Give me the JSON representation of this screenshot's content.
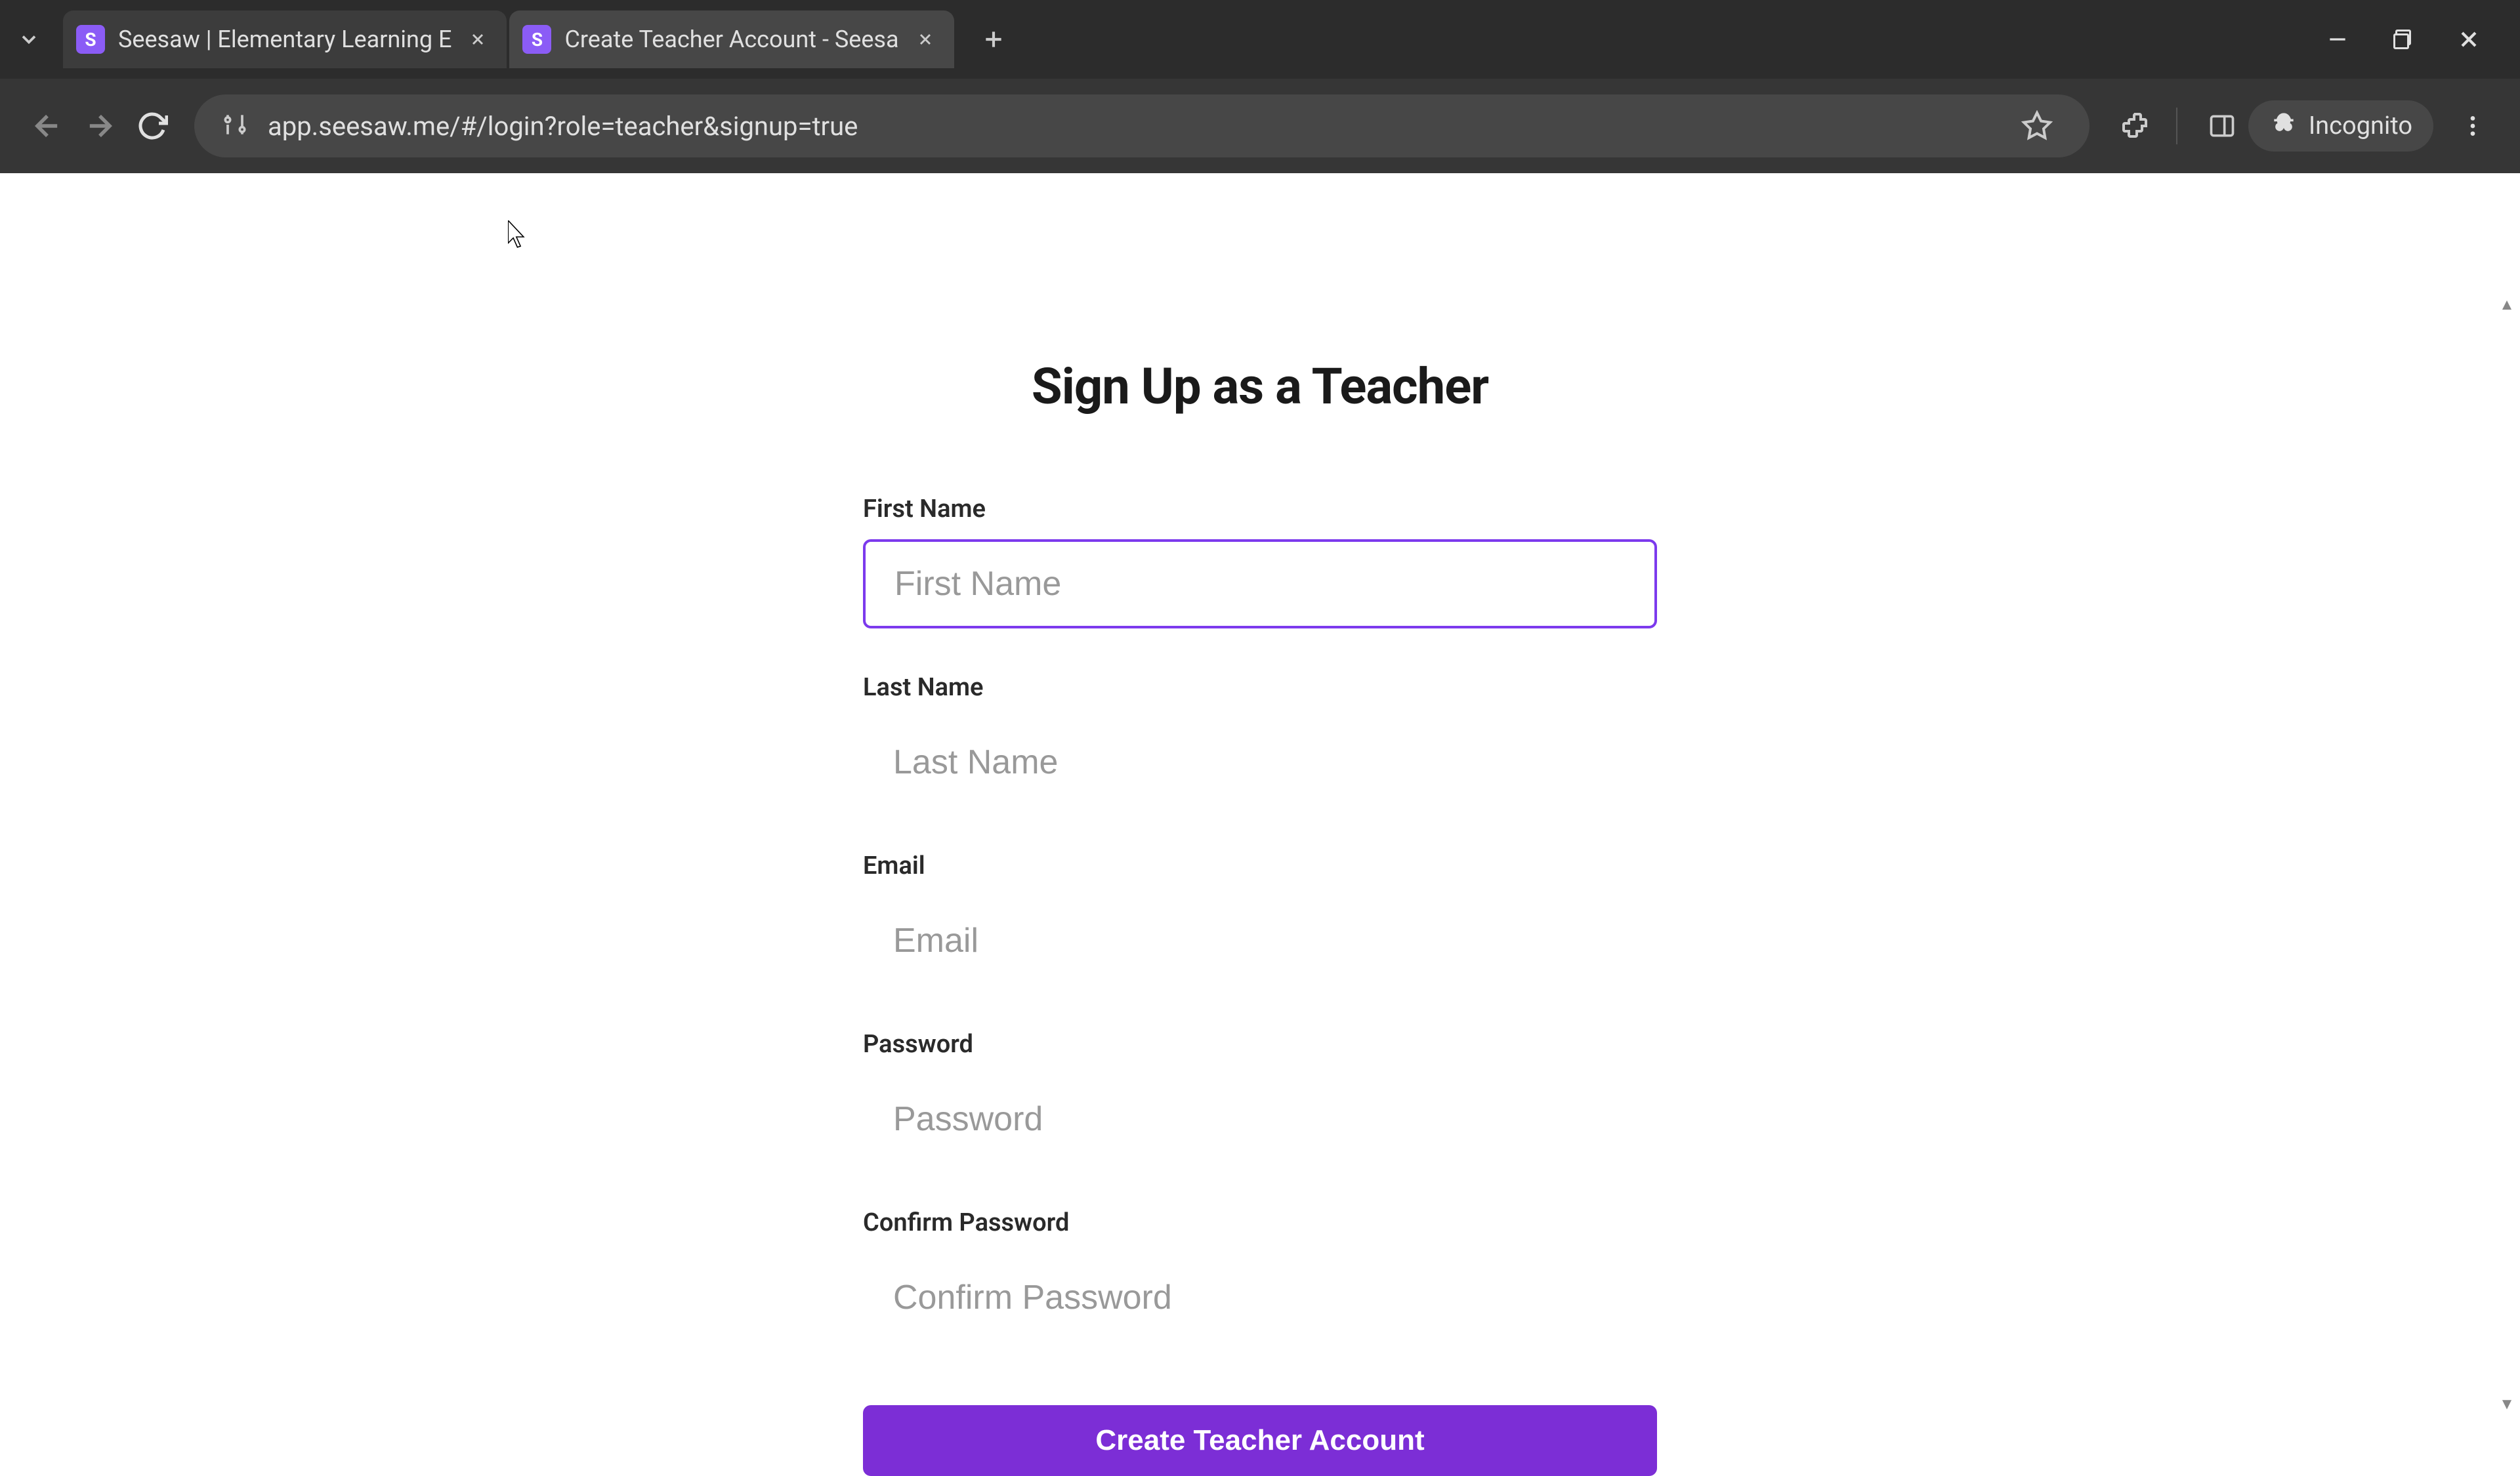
{
  "browser": {
    "tabs": [
      {
        "title": "Seesaw | Elementary Learning E",
        "favicon": "S"
      },
      {
        "title": "Create Teacher Account - Seesa",
        "favicon": "S"
      }
    ],
    "url": "app.seesaw.me/#/login?role=teacher&signup=true",
    "incognito": "Incognito"
  },
  "page": {
    "title": "Sign Up as a Teacher",
    "fields": {
      "first_name": {
        "label": "First Name",
        "placeholder": "First Name"
      },
      "last_name": {
        "label": "Last Name",
        "placeholder": "Last Name"
      },
      "email": {
        "label": "Email",
        "placeholder": "Email"
      },
      "password": {
        "label": "Password",
        "placeholder": "Password"
      },
      "confirm_password": {
        "label": "Confirm Password",
        "placeholder": "Confirm Password"
      }
    },
    "submit": "Create Teacher Account"
  }
}
